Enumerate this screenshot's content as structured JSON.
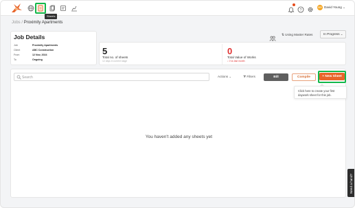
{
  "topbar": {
    "tooltip": "Sheets",
    "user_name": "David Young",
    "user_initials": "DY",
    "active_nav": "sheets",
    "nav_icons": [
      "globe-icon",
      "sheets-icon",
      "documents-icon",
      "reports-icon",
      "analytics-icon"
    ],
    "right_icons": [
      "bell-icon",
      "help-icon",
      "gear-icon"
    ]
  },
  "breadcrumb": {
    "root": "Jobs",
    "separator": "/",
    "current": "Proximity Apartments"
  },
  "job": {
    "title": "Job Details",
    "fields": [
      {
        "key": "Job",
        "value": "Proximity Apartments"
      },
      {
        "key": "Client",
        "value": "ABC Construction"
      },
      {
        "key": "From",
        "value": "12 Nov, 2024"
      },
      {
        "key": "To",
        "value": "Ongoing"
      }
    ]
  },
  "stats": {
    "sheets_count": "5",
    "sheets_label": "Total no. of sheets",
    "sheets_sub": "12 days in current stage",
    "value": "0",
    "value_label": "Total Value of Works",
    "value_sub": "0 vs last month"
  },
  "rates_label": "Using Master Rates",
  "status": "In Progress",
  "toolbar": {
    "search_placeholder": "Search",
    "actions_label": "Actions",
    "filters_label": "Filters",
    "bill_label": "Bill",
    "compile_label": "Compile",
    "new_sheet_label": "+ New Sheet"
  },
  "popover_text": "Click here to create your first daywork sheet for this job.",
  "empty_message": "You haven't added any sheets yet",
  "help_tab": "Need a hand?",
  "colors": {
    "accent": "#e8652a",
    "highlight": "#12b84a",
    "value_red": "#e03131"
  }
}
